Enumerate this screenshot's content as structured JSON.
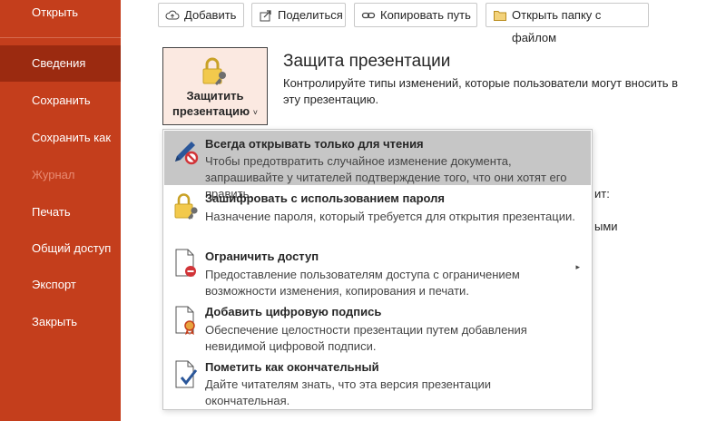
{
  "sidebar": {
    "items": [
      {
        "label": "Открыть",
        "state": "normal"
      },
      {
        "label": "Сведения",
        "state": "active"
      },
      {
        "label": "Сохранить",
        "state": "normal"
      },
      {
        "label": "Сохранить как",
        "state": "normal"
      },
      {
        "label": "Журнал",
        "state": "disabled"
      },
      {
        "label": "Печать",
        "state": "normal"
      },
      {
        "label": "Общий доступ",
        "state": "normal"
      },
      {
        "label": "Экспорт",
        "state": "normal"
      },
      {
        "label": "Закрыть",
        "state": "normal"
      }
    ]
  },
  "toolbar": {
    "add": "Добавить",
    "share": "Поделиться",
    "copy_path": "Копировать путь",
    "open_folder": "Открыть папку с файлом"
  },
  "protect": {
    "button_label_1": "Защитить",
    "button_label_2": "презентацию",
    "caret": "˅",
    "title": "Защита презентации",
    "description": "Контролируйте типы изменений, которые пользователи могут вносить в эту презентацию."
  },
  "background_peek": {
    "line1": "ит:",
    "line2": "ыми"
  },
  "menu": {
    "items": [
      {
        "title": "Всегда открывать только для чтения",
        "description": "Чтобы предотвратить случайное изменение документа, запрашивайте у читателей подтверждение того, что они хотят его править.",
        "icon": "pencil-prohibited-icon",
        "highlighted": true
      },
      {
        "title": "Зашифровать с использованием пароля",
        "description": "Назначение пароля, который требуется для открытия презентации.",
        "icon": "lock-key-icon"
      },
      {
        "title": "Ограничить доступ",
        "description": "Предоставление пользователям доступа с ограничением возможности изменения, копирования и печати.",
        "icon": "document-restricted-icon",
        "submenu_arrow": "▸"
      },
      {
        "title": "Добавить цифровую подпись",
        "description": "Обеспечение целостности презентации путем добавления невидимой цифровой подписи.",
        "icon": "document-ribbon-icon"
      },
      {
        "title": "Пометить как окончательный",
        "description": "Дайте читателям знать, что эта версия презентации окончательная.",
        "icon": "document-check-icon"
      }
    ]
  },
  "colors": {
    "sidebar_bg": "#c43e1c",
    "sidebar_active": "#9b2a10",
    "menu_highlight": "#c6c6c6",
    "accent_blue": "#2b579a"
  }
}
